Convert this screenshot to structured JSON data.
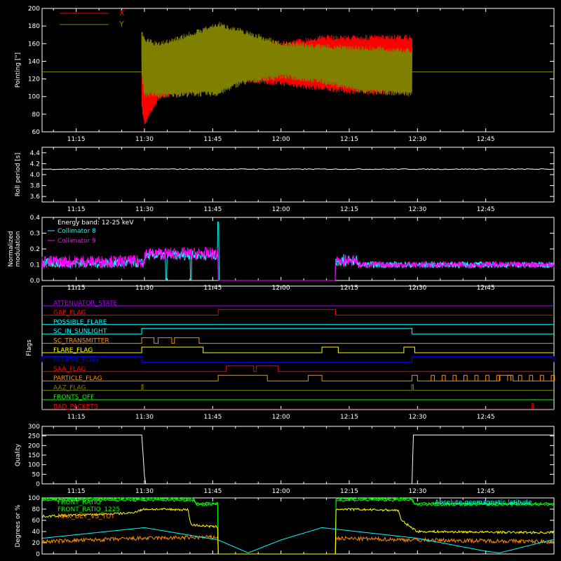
{
  "colors": {
    "axis": "#ffffff",
    "x_red": "#ff0000",
    "y_olive": "#808000",
    "cyan": "#00ffff",
    "magenta": "#ff00ff",
    "green": "#00ff00",
    "yellow": "#ffff00",
    "orange": "#ff8c00",
    "purple": "#aa00ff",
    "blue": "#0000ff"
  },
  "time_ticks": [
    "11:15",
    "11:30",
    "11:45",
    "12:00",
    "12:15",
    "12:30",
    "12:45"
  ],
  "time_range_hours": [
    11.125,
    13.0
  ],
  "chart_data": [
    {
      "type": "line",
      "panel": "pointing",
      "ylabel": "Pointing [\"]",
      "ylim": [
        60,
        200
      ],
      "yticks": [
        "60",
        "80",
        "100",
        "120",
        "140",
        "160",
        "180",
        "200"
      ],
      "legend": [
        "X",
        "Y"
      ],
      "legend_placement": "top-left",
      "data_start": "11:29",
      "data_end": "12:29",
      "reference_line": 128,
      "series": [
        {
          "name": "X",
          "color_key": "x_red",
          "upper": [
            [
              11.49,
              172
            ],
            [
              11.5,
              148
            ],
            [
              11.55,
              160
            ],
            [
              11.7,
              168
            ],
            [
              11.85,
              164
            ],
            [
              12.0,
              163
            ],
            [
              12.15,
              170
            ],
            [
              12.3,
              170
            ],
            [
              12.48,
              170
            ]
          ],
          "lower": [
            [
              11.49,
              85
            ],
            [
              11.5,
              65
            ],
            [
              11.55,
              95
            ],
            [
              11.7,
              110
            ],
            [
              11.85,
              116
            ],
            [
              12.0,
              112
            ],
            [
              12.15,
              106
            ],
            [
              12.3,
              102
            ],
            [
              12.48,
              102
            ]
          ]
        },
        {
          "name": "Y",
          "color_key": "y_olive",
          "upper": [
            [
              11.49,
              175
            ],
            [
              11.5,
              168
            ],
            [
              11.55,
              162
            ],
            [
              11.7,
              177
            ],
            [
              11.77,
              185
            ],
            [
              11.85,
              178
            ],
            [
              12.0,
              163
            ],
            [
              12.15,
              160
            ],
            [
              12.3,
              158
            ],
            [
              12.48,
              155
            ]
          ],
          "lower": [
            [
              11.49,
              120
            ],
            [
              11.5,
              100
            ],
            [
              11.55,
              98
            ],
            [
              11.7,
              100
            ],
            [
              11.77,
              100
            ],
            [
              11.85,
              112
            ],
            [
              12.0,
              120
            ],
            [
              12.15,
              114
            ],
            [
              12.3,
              103
            ],
            [
              12.48,
              100
            ]
          ]
        }
      ]
    },
    {
      "type": "line",
      "panel": "roll",
      "ylabel": "Roll period [s]",
      "ylim": [
        3.5,
        4.5
      ],
      "yticks": [
        "3.6",
        "3.8",
        "4.0",
        "4.2",
        "4.4"
      ],
      "series": [
        {
          "name": "",
          "color_key": "axis",
          "points": [
            [
              11.125,
              4.1
            ],
            [
              13.0,
              4.1
            ]
          ]
        }
      ]
    },
    {
      "type": "line",
      "panel": "modulation",
      "ylabel": "Normalized modulation",
      "ylim": [
        0,
        0.4
      ],
      "yticks": [
        "0.0",
        "0.1",
        "0.2",
        "0.3",
        "0.4"
      ],
      "annotation": "Energy band: 12-25 keV",
      "legend": [
        "Collimator 8",
        "Collimator 9"
      ],
      "legend_placement": "top-left",
      "series": [
        {
          "name": "Collimator 8",
          "color_key": "cyan",
          "segments": [
            {
              "from": 11.125,
              "to": 11.77,
              "base": 0.11,
              "noise": 0.03
            },
            {
              "from": 12.2,
              "to": 13.0,
              "base": 0.1,
              "noise": 0.02
            }
          ],
          "spikes": [
            [
              11.58,
              0.0
            ],
            [
              11.67,
              0.0
            ],
            [
              11.77,
              0.37
            ]
          ]
        },
        {
          "name": "Collimator 9",
          "color_key": "magenta",
          "segments": [
            {
              "from": 11.125,
              "to": 11.77,
              "base": 0.12,
              "noise": 0.04
            },
            {
              "from": 12.2,
              "to": 13.0,
              "base": 0.1,
              "noise": 0.02
            }
          ],
          "gap": [
            11.77,
            12.2
          ]
        }
      ]
    },
    {
      "type": "table",
      "panel": "flags",
      "ylabel": "Flags",
      "rows": [
        {
          "name": "ATTENUATOR_STATE",
          "color_key": "purple",
          "on": []
        },
        {
          "name": "GAP_FLAG",
          "color_key": "x_red",
          "on": [
            [
              11.77,
              12.2
            ]
          ]
        },
        {
          "name": "POSSIBLE_FLARE",
          "color_key": "cyan",
          "on": []
        },
        {
          "name": "SC_IN_SUNLIGHT",
          "color_key": "cyan",
          "on": [
            [
              11.49,
              12.48
            ]
          ]
        },
        {
          "name": "SC_TRANSMITTER",
          "color_key": "orange",
          "on": [
            [
              11.49,
              11.535
            ],
            [
              11.55,
              11.6
            ],
            [
              11.61,
              11.7
            ]
          ]
        },
        {
          "name": "FLARE_FLAG",
          "color_key": "yellow",
          "on": [
            [
              11.49,
              11.715
            ],
            [
              12.15,
              12.21
            ],
            [
              12.45,
              12.49
            ]
          ]
        },
        {
          "name": "ECLIPSE_FLAG",
          "color_key": "blue",
          "on": [
            [
              11.125,
              11.49
            ],
            [
              12.48,
              13.0
            ]
          ]
        },
        {
          "name": "SAA_FLAG",
          "color_key": "x_red",
          "on": [
            [
              11.8,
              11.9
            ],
            [
              11.91,
              11.99
            ]
          ]
        },
        {
          "name": "PARTICLE_FLAG",
          "color_key": "orange",
          "on": [
            [
              11.77,
              11.95
            ],
            [
              12.1,
              12.15
            ],
            [
              12.48,
              12.5
            ],
            [
              12.8,
              12.85
            ]
          ]
        },
        {
          "name": "AAZ_FLAG",
          "color_key": "y_olive",
          "on": [
            [
              11.49,
              11.495
            ],
            [
              12.48,
              12.485
            ]
          ]
        },
        {
          "name": "FRONTS_OFF",
          "color_key": "green",
          "on": []
        },
        {
          "name": "BAD_PACKETS",
          "color_key": "x_red",
          "on": [
            [
              12.92,
              12.925
            ]
          ]
        }
      ]
    },
    {
      "type": "line",
      "panel": "quality",
      "ylabel": "Quality",
      "ylim": [
        0,
        300
      ],
      "yticks": [
        "0",
        "50",
        "100",
        "150",
        "200",
        "250",
        "300"
      ],
      "series": [
        {
          "name": "",
          "color_key": "axis",
          "points": [
            [
              11.125,
              255
            ],
            [
              11.49,
              255
            ],
            [
              11.495,
              150
            ],
            [
              11.5,
              40
            ],
            [
              11.505,
              0
            ],
            [
              12.48,
              0
            ],
            [
              12.485,
              255
            ],
            [
              13.0,
              255
            ]
          ]
        }
      ]
    },
    {
      "type": "line",
      "panel": "ratios",
      "ylabel": "Degrees or %",
      "ylim": [
        0,
        100
      ],
      "yticks": [
        "0",
        "20",
        "40",
        "60",
        "80",
        "100"
      ],
      "legend": [
        "FRONT_RATIO",
        "FRONT_RATIO_1225",
        "MAX_DET_VS_TOT"
      ],
      "legend_placement": "top-left",
      "annotation": "Absolute geomagnetic latitude",
      "series": [
        {
          "name": "FRONT_RATIO",
          "color_key": "green",
          "points": [
            [
              11.125,
              99
            ],
            [
              11.68,
              99
            ],
            [
              11.69,
              90
            ],
            [
              11.77,
              90
            ],
            [
              11.77,
              0
            ],
            [
              12.2,
              0
            ],
            [
              12.2,
              99
            ],
            [
              12.48,
              99
            ],
            [
              12.49,
              90
            ],
            [
              13.0,
              90
            ]
          ]
        },
        {
          "name": "FRONT_RATIO_1225",
          "color_key": "green",
          "points": [
            [
              11.125,
              96
            ],
            [
              11.68,
              96
            ],
            [
              11.69,
              88
            ],
            [
              11.77,
              88
            ],
            [
              11.77,
              0
            ],
            [
              12.2,
              0
            ],
            [
              12.2,
              96
            ],
            [
              12.48,
              96
            ],
            [
              12.49,
              88
            ],
            [
              13.0,
              88
            ]
          ]
        },
        {
          "name": "MAX_DET_VS_TOT",
          "color_key": "orange",
          "points": [
            [
              11.125,
              22
            ],
            [
              11.3,
              25
            ],
            [
              11.5,
              28
            ],
            [
              11.77,
              30
            ],
            [
              11.77,
              0
            ],
            [
              12.2,
              0
            ],
            [
              12.2,
              28
            ],
            [
              12.5,
              25
            ],
            [
              13.0,
              22
            ]
          ]
        },
        {
          "name": "yellow_ratio",
          "color_key": "yellow",
          "points": [
            [
              11.125,
              67
            ],
            [
              11.3,
              70
            ],
            [
              11.45,
              73
            ],
            [
              11.5,
              80
            ],
            [
              11.66,
              79
            ],
            [
              11.67,
              52
            ],
            [
              11.77,
              48
            ],
            [
              11.77,
              0
            ],
            [
              12.2,
              0
            ],
            [
              12.2,
              80
            ],
            [
              12.43,
              78
            ],
            [
              12.44,
              60
            ],
            [
              12.5,
              40
            ],
            [
              13.0,
              38
            ]
          ]
        },
        {
          "name": "latitude",
          "color_key": "cyan",
          "points": [
            [
              11.125,
              28
            ],
            [
              11.5,
              47
            ],
            [
              11.77,
              25
            ],
            [
              11.88,
              2
            ],
            [
              12.0,
              25
            ],
            [
              12.15,
              47
            ],
            [
              12.5,
              28
            ],
            [
              12.75,
              5
            ],
            [
              12.8,
              2
            ],
            [
              12.95,
              20
            ],
            [
              13.0,
              26
            ]
          ]
        }
      ]
    }
  ]
}
